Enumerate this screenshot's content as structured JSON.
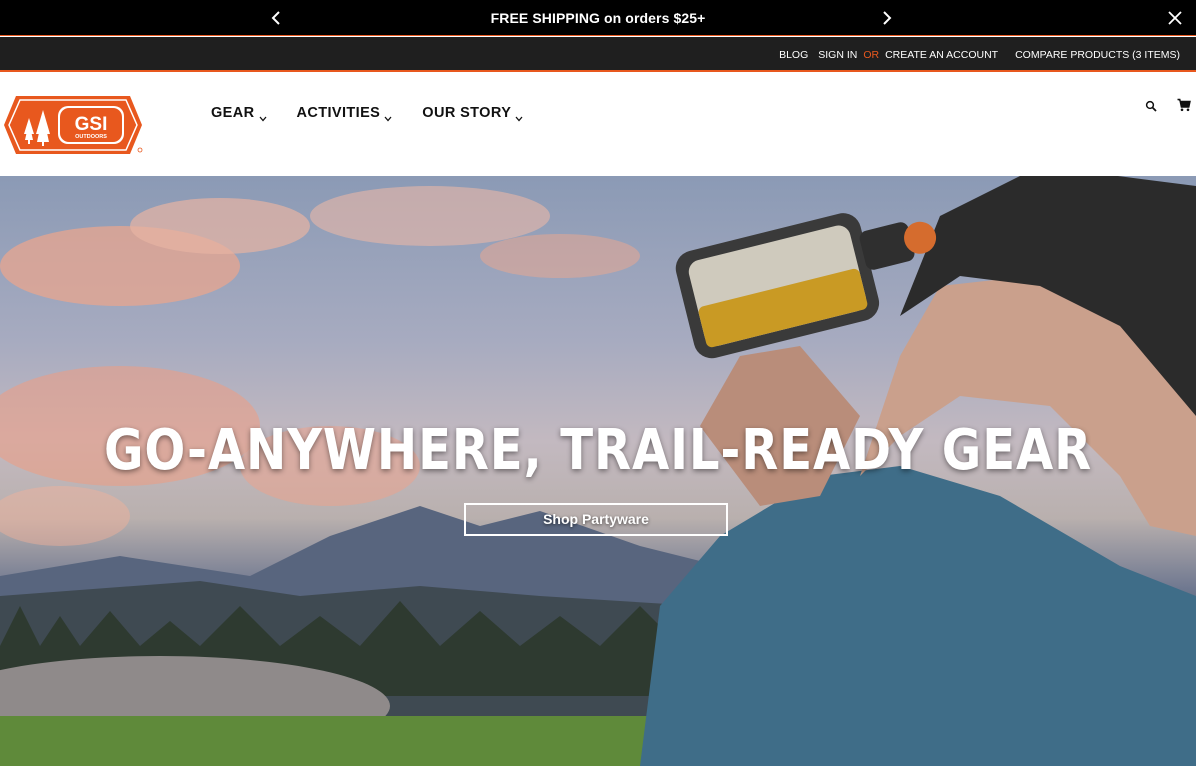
{
  "announcement": {
    "message": "FREE SHIPPING on orders $25+"
  },
  "utility": {
    "blog": "BLOG",
    "sign_in": "SIGN IN",
    "or": "OR",
    "create_account": "CREATE AN ACCOUNT",
    "compare": "COMPARE PRODUCTS (3 ITEMS)"
  },
  "brand": {
    "name": "GSI",
    "sub": "OUTDOORS",
    "accent": "#e8581e"
  },
  "nav": {
    "items": [
      {
        "label": "GEAR"
      },
      {
        "label": "ACTIVITIES"
      },
      {
        "label": "OUR STORY"
      }
    ]
  },
  "hero": {
    "headline": "GO-ANYWHERE, TRAIL-READY GEAR",
    "cta": "Shop Partyware"
  },
  "icons": {
    "search": "search-icon",
    "cart": "cart-icon",
    "close": "close-icon",
    "prev": "chevron-left-icon",
    "next": "chevron-right-icon"
  }
}
